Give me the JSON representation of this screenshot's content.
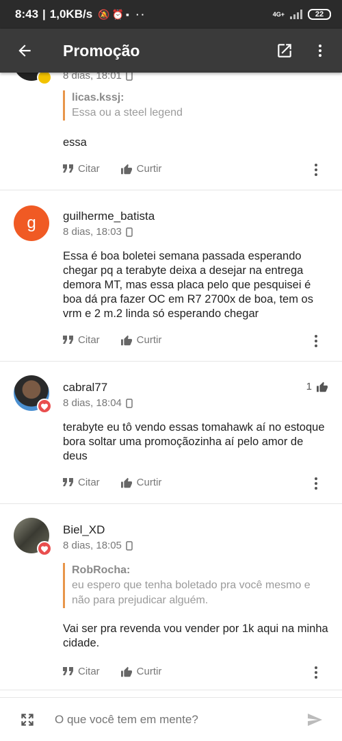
{
  "statusbar": {
    "time": "8:43",
    "net": "1,0KB/s",
    "signal": "4G+",
    "battery": "22"
  },
  "appbar": {
    "title": "Promoção"
  },
  "comments": [
    {
      "time": "8 dias, 18:01",
      "quote": {
        "author": "licas.kssj:",
        "text": "Essa ou a steel legend"
      },
      "body": "essa",
      "actions": {
        "cite": "Citar",
        "like": "Curtir"
      }
    },
    {
      "username": "guilherme_batista",
      "avatar_letter": "g",
      "avatar_color": "#f05a24",
      "time": "8 dias, 18:03",
      "body": "Essa é boa boletei semana passada esperando chegar pq a terabyte deixa a desejar na entrega demora MT, mas essa placa pelo que pesquisei é boa dá pra fazer OC em R7 2700x de boa, tem os vrm e 2 m.2 linda só esperando chegar",
      "actions": {
        "cite": "Citar",
        "like": "Curtir"
      }
    },
    {
      "username": "cabral77",
      "time": "8 dias, 18:04",
      "likes": "1",
      "body": "terabyte eu tô vendo essas tomahawk aí no estoque bora soltar uma promoçãozinha aí pelo amor de deus",
      "actions": {
        "cite": "Citar",
        "like": "Curtir"
      }
    },
    {
      "username": "Biel_XD",
      "time": "8 dias, 18:05",
      "quote": {
        "author": "RobRocha:",
        "text": "eu espero que tenha boletado pra você mesmo e não para prejudicar alguém."
      },
      "body": "Vai ser pra revenda vou vender por 1k aqui na minha cidade.",
      "actions": {
        "cite": "Citar",
        "like": "Curtir"
      }
    }
  ],
  "composer": {
    "placeholder": "O que você tem em mente?"
  },
  "colors": {
    "accent": "#e8954a",
    "badge_red": "#e94e4e",
    "badge_yellow": "#f2c200",
    "appbar": "#3a3a3a"
  }
}
